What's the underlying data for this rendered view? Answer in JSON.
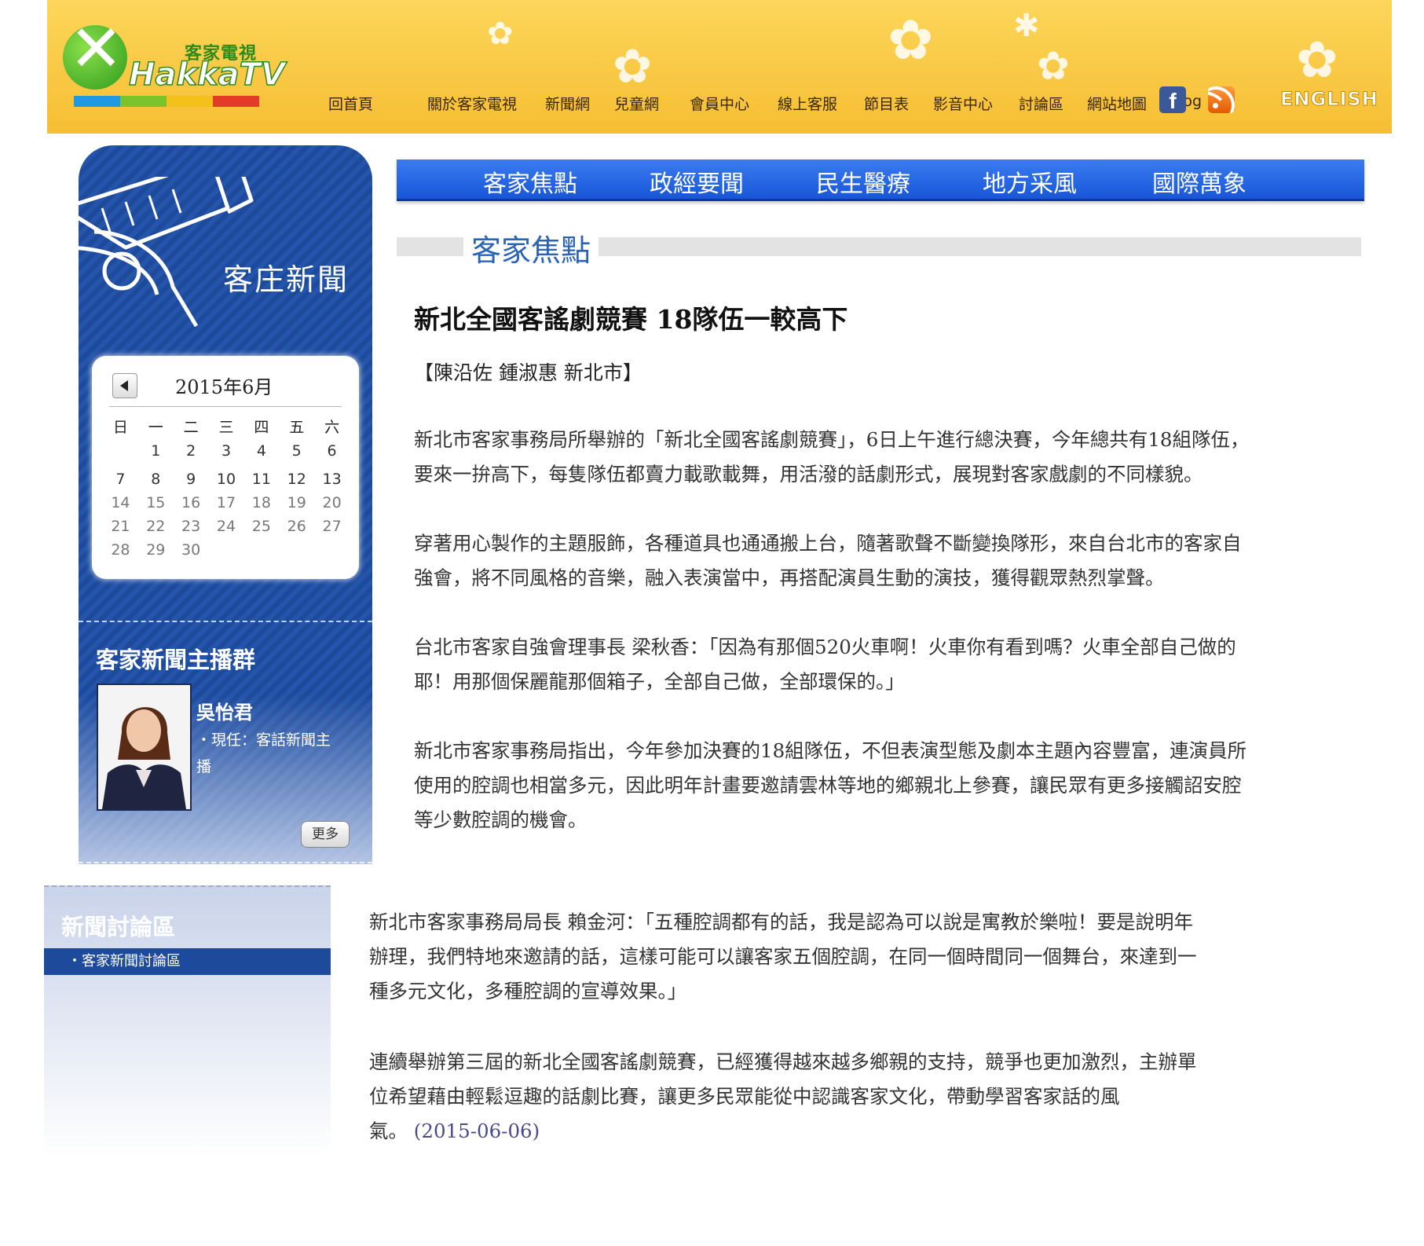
{
  "header": {
    "logo_cn": "客家電視",
    "logo_en": "HakkaTV",
    "nav": [
      {
        "label": "回首頁"
      },
      {
        "label": "關於客家電視"
      },
      {
        "label": "新聞網"
      },
      {
        "label": "兒童網"
      },
      {
        "label": "會員中心"
      },
      {
        "label": "線上客服"
      },
      {
        "label": "節目表"
      },
      {
        "label": "影音中心"
      },
      {
        "label": "討論區"
      },
      {
        "label": "網站地圖"
      },
      {
        "label": "Blog"
      }
    ],
    "english_label": "ENGLISH",
    "colors": {
      "bar": [
        "#1d9ae0",
        "#7cc22b",
        "#f2c21a",
        "#e23b2b"
      ]
    }
  },
  "sidebar": {
    "title": "客庄新聞",
    "calendar": {
      "month_label": "2015年6月",
      "weekdays": [
        "日",
        "一",
        "二",
        "三",
        "四",
        "五",
        "六"
      ],
      "weeks": [
        [
          "",
          "1",
          "2",
          "3",
          "4",
          "5",
          "6"
        ],
        [
          "7",
          "8",
          "9",
          "10",
          "11",
          "12",
          "13"
        ],
        [
          "14",
          "15",
          "16",
          "17",
          "18",
          "19",
          "20"
        ],
        [
          "21",
          "22",
          "23",
          "24",
          "25",
          "26",
          "27"
        ],
        [
          "28",
          "29",
          "30",
          "",
          "",
          "",
          ""
        ]
      ]
    },
    "anchors_title": "客家新聞主播群",
    "anchor": {
      "name": "吳怡君",
      "role_line1": "・現任：客話新聞主",
      "role_line2": "播"
    },
    "more_label": "更多"
  },
  "discussion": {
    "title": "新聞討論區",
    "item": "・客家新聞討論區"
  },
  "categories": [
    "客家焦點",
    "政經要聞",
    "民生醫療",
    "地方采風",
    "國際萬象"
  ],
  "section_title": "客家焦點",
  "article": {
    "title": "新北全國客謠劇競賽 18隊伍一較高下",
    "byline": "【陳沿佐 鍾淑惠 新北市】",
    "paragraphs": [
      {
        "lines": [
          "新北市客家事務局所舉辦的「新北全國客謠劇競賽」，6日上午進行總決賽，今年總共有18組隊伍，",
          "要來一拚高下，每隻隊伍都賣力載歌載舞，用活潑的話劇形式，展現對客家戲劇的不同樣貌。"
        ]
      },
      {
        "lines": [
          "穿著用心製作的主題服飾，各種道具也通通搬上台，隨著歌聲不斷變換隊形，來自台北市的客家自",
          "強會，將不同風格的音樂，融入表演當中，再搭配演員生動的演技，獲得觀眾熱烈掌聲。"
        ]
      },
      {
        "lines": [
          "台北市客家自強會理事長 梁秋香：「因為有那個520火車啊！火車你有看到嗎？火車全部自己做的",
          "耶！用那個保麗龍那個箱子，全部自己做，全部環保的。」"
        ]
      },
      {
        "lines": [
          "新北市客家事務局指出，今年參加決賽的18組隊伍，不但表演型態及劇本主題內容豐富，連演員所",
          "使用的腔調也相當多元，因此明年計畫要邀請雲林等地的鄉親北上參賽，讓民眾有更多接觸詔安腔",
          "等少數腔調的機會。"
        ]
      },
      {
        "lines": [
          "新北市客家事務局局長 賴金河：「五種腔調都有的話，我是認為可以說是寓教於樂啦！要是說明年",
          "辦理，我們特地來邀請的話，這樣可能可以讓客家五個腔調，在同一個時間同一個舞台，來達到一",
          "種多元文化，多種腔調的宣導效果。」"
        ]
      },
      {
        "lines": [
          "連續舉辦第三屆的新北全國客謠劇競賽，已經獲得越來越多鄉親的支持，競爭也更加激烈，主辦單",
          "位希望藉由輕鬆逗趣的話劇比賽，讓更多民眾能從中認識客家文化，帶動學習客家話的風"
        ]
      }
    ],
    "last_line_text": "氣。",
    "date": "(2015-06-06)"
  }
}
